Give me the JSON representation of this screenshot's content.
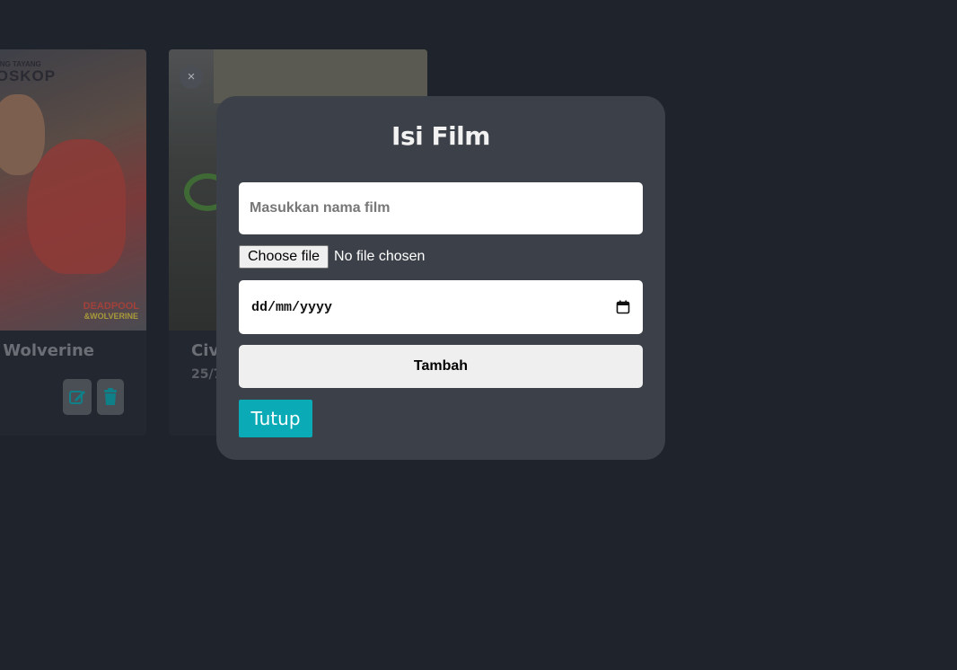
{
  "cards": [
    {
      "poster_top_text": "ANG TAYANG",
      "poster_brand": "IOSKOP",
      "poster_logo_main": "DEADPOOL",
      "poster_logo_sub": "&WOLVERINE",
      "title": "x Wolverine",
      "edit_icon": "edit-icon",
      "delete_icon": "trash-icon"
    },
    {
      "close_symbol": "×",
      "title": "Civ",
      "date": "25/7"
    }
  ],
  "modal": {
    "title": "Isi Film",
    "name_placeholder": "Masukkan nama film",
    "file_button_label": "Choose file",
    "file_status": "No file chosen",
    "date_placeholder": "dd/mm/yyyy",
    "add_button_label": "Tambah",
    "close_button_label": "Tutup"
  },
  "colors": {
    "background": "#1f232b",
    "modal": "#3c4048",
    "accent": "#0aaab7"
  }
}
